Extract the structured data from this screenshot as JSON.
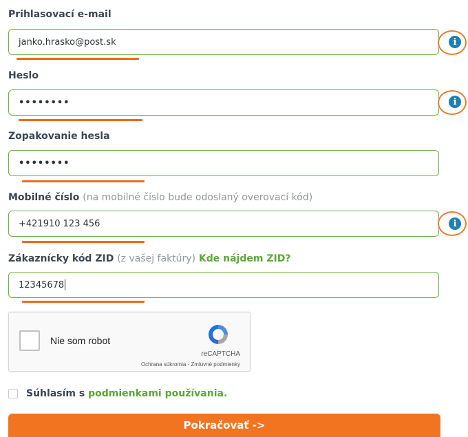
{
  "form": {
    "email": {
      "label": "Prihlasovací e-mail",
      "value": "janko.hrasko@post.sk"
    },
    "password": {
      "label": "Heslo",
      "value": "••••••••"
    },
    "password_repeat": {
      "label": "Zopakovanie hesla",
      "value": "••••••••"
    },
    "mobile": {
      "label": "Mobilné číslo",
      "hint": "(na mobilné číslo bude odoslaný overovací kód)",
      "value": "+421910 123 456"
    },
    "zid": {
      "label": "Zákaznícky kód ZID",
      "hint": "(z vašej faktúry)",
      "link": "Kde nájdem ZID?",
      "value": "12345678"
    }
  },
  "info_icon": {
    "icon": "info-circle-icon",
    "glyph": "i"
  },
  "recaptcha": {
    "checkbox_label": "Nie som robot",
    "brand": "reCAPTCHA",
    "links": "Ochrana súkromia - Zmluvné podmienky"
  },
  "agreement": {
    "prefix": "Súhlasím s",
    "link": "podmienkami používania."
  },
  "submit_label": "Pokračovať ->",
  "colors": {
    "accent_orange": "#f27420",
    "field_border_green": "#6fb13e",
    "link_green": "#5aa834",
    "info_blue": "#1f7fb4"
  }
}
